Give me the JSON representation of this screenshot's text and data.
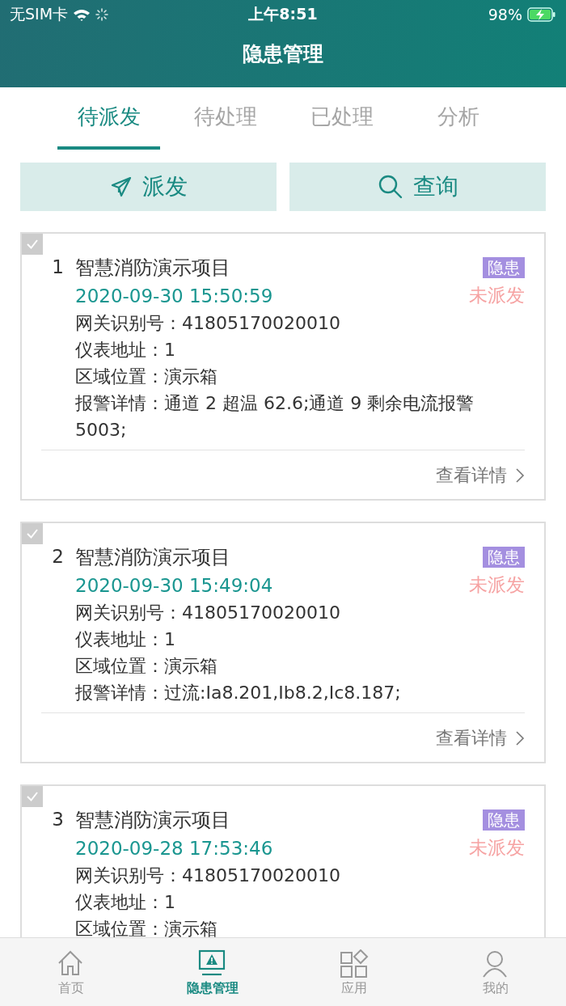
{
  "status_bar": {
    "carrier": "无SIM卡",
    "time": "上午8:51",
    "battery": "98%"
  },
  "header": {
    "title": "隐患管理"
  },
  "tabs": [
    {
      "label": "待派发",
      "selected": true
    },
    {
      "label": "待处理",
      "selected": false
    },
    {
      "label": "已处理",
      "selected": false
    },
    {
      "label": "分析",
      "selected": false
    }
  ],
  "actions": [
    {
      "kind": "send",
      "label": "派发"
    },
    {
      "kind": "search",
      "label": "查询"
    }
  ],
  "records": [
    {
      "checked": false,
      "index": "1",
      "title": "智慧消防演示项目",
      "time": "2020-09-30 15:50:59",
      "tag": "隐患",
      "status": "未派发",
      "fields": [
        "网关识别号：41805170020010",
        "仪表地址：1",
        "区域位置：演示箱",
        "报警详情：通道 2 超温 62.6;通道 9 剩余电流报警 5003;"
      ],
      "link": "查看详情"
    },
    {
      "checked": false,
      "index": "2",
      "title": "智慧消防演示项目",
      "time": "2020-09-30 15:49:04",
      "tag": "隐患",
      "status": "未派发",
      "fields": [
        "网关识别号：41805170020010",
        "仪表地址：1",
        "区域位置：演示箱",
        "报警详情：过流:Ia8.201,Ib8.2,Ic8.187;"
      ],
      "link": "查看详情"
    },
    {
      "checked": false,
      "index": "3",
      "title": "智慧消防演示项目",
      "time": "2020-09-28 17:53:46",
      "tag": "隐患",
      "status": "未派发",
      "fields": [
        "网关识别号：41805170020010",
        "仪表地址：1",
        "区域位置：演示箱"
      ]
    }
  ],
  "tab_bar": [
    {
      "kind": "home",
      "label": "首页",
      "selected": false
    },
    {
      "kind": "alert",
      "label": "隐患管理",
      "selected": true
    },
    {
      "kind": "apps",
      "label": "应用",
      "selected": false
    },
    {
      "kind": "user",
      "label": "我的",
      "selected": false
    }
  ]
}
